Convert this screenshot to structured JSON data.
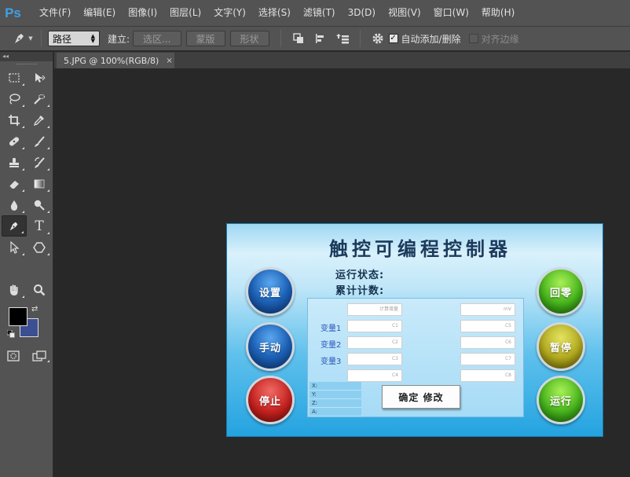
{
  "app": {
    "logo": "Ps"
  },
  "menu": [
    "文件(F)",
    "编辑(E)",
    "图像(I)",
    "图层(L)",
    "文字(Y)",
    "选择(S)",
    "滤镜(T)",
    "3D(D)",
    "视图(V)",
    "窗口(W)",
    "帮助(H)"
  ],
  "options": {
    "tool_icon": "pen-icon",
    "mode_select": "路径",
    "make_label": "建立:",
    "selection_button": "选区...",
    "mask_button": "蒙版",
    "shape_button": "形状",
    "auto_add_delete": {
      "label": "自动添加/删除",
      "checked": true
    },
    "align_edges": {
      "label": "对齐边缘",
      "checked": false
    }
  },
  "toolbox": {
    "collapse": "◂◂",
    "tools": [
      "marquee-icon",
      "move-icon",
      "lasso-icon",
      "quick-select-icon",
      "crop-icon",
      "eyedropper-icon",
      "healing-icon",
      "brush-icon",
      "stamp-icon",
      "history-brush-icon",
      "eraser-icon",
      "gradient-icon",
      "blur-icon",
      "dodge-icon",
      "pen-icon",
      "type-icon",
      "path-select-icon",
      "shape-icon",
      "hand-icon",
      "zoom-icon"
    ],
    "type_glyph": "T",
    "foreground_color": "#000000",
    "background_color": "#3c4f93"
  },
  "document": {
    "tab_title": "5.JPG @ 100%(RGB/8)",
    "close": "×"
  },
  "hmi": {
    "title": "触控可编程控制器",
    "status_run": "运行状态:",
    "status_count": "累计计数:",
    "left_buttons": [
      "设置",
      "手动",
      "停止"
    ],
    "right_buttons": [
      "回零",
      "暂停",
      "运行"
    ],
    "variables": [
      "变量1",
      "变量2",
      "变量3"
    ],
    "left_fields": [
      "计算增量",
      "C1",
      "C2",
      "C3",
      "C4"
    ],
    "right_fields": [
      "mV",
      "C5",
      "C6",
      "C7",
      "C8"
    ],
    "xyz": [
      "X:",
      "Y:",
      "Z:",
      "A:"
    ],
    "confirm_button": "确定 修改"
  }
}
